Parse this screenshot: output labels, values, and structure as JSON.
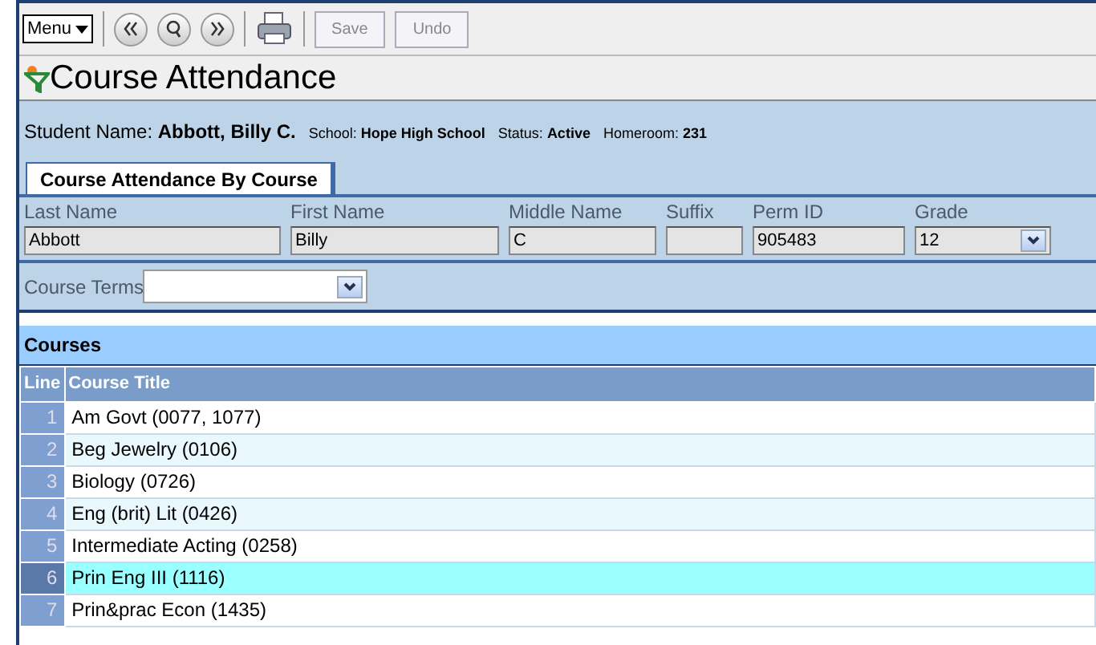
{
  "toolbar": {
    "menu": "Menu",
    "buttons": [
      {
        "label": "Save",
        "disabled": true
      },
      {
        "label": "Undo",
        "disabled": true
      }
    ]
  },
  "title": "Course Attendance",
  "student": [
    {
      "label": "Student Name:",
      "value": "Abbott, Billy C.",
      "kind": "large"
    },
    {
      "label": "School:",
      "value": "Hope High School",
      "kind": "small"
    },
    {
      "label": "Status:",
      "value": "Active",
      "kind": "small"
    },
    {
      "label": "Homeroom:",
      "value": "231",
      "kind": "small"
    }
  ],
  "tabs": [
    {
      "label": "Course Attendance By Course",
      "selected": true
    }
  ],
  "fields": [
    {
      "label": "Last Name",
      "value": "Abbott",
      "kind": "text"
    },
    {
      "label": "First Name",
      "value": "Billy",
      "kind": "text"
    },
    {
      "label": "Middle Name",
      "value": "C",
      "kind": "text"
    },
    {
      "label": "Suffix",
      "kind": "text"
    },
    {
      "label": "Perm ID",
      "value": "905483",
      "kind": "text"
    },
    {
      "label": "Grade",
      "value": "12",
      "kind": "select"
    }
  ],
  "course_terms": {
    "label": "Course Terms"
  },
  "courses": {
    "title": "Courses",
    "columns": [
      "Line",
      "Course Title"
    ],
    "rows": [
      {
        "line": "1",
        "title": "Am Govt (0077, 1077)",
        "selected": false
      },
      {
        "line": "2",
        "title": "Beg Jewelry (0106)",
        "selected": false
      },
      {
        "line": "3",
        "title": "Biology (0726)",
        "selected": false
      },
      {
        "line": "4",
        "title": "Eng (brit) Lit (0426)",
        "selected": false
      },
      {
        "line": "5",
        "title": "Intermediate Acting (0258)",
        "selected": false
      },
      {
        "line": "6",
        "title": "Prin Eng III (1116)",
        "selected": true
      },
      {
        "line": "7",
        "title": "Prin&prac Econ (1435)",
        "selected": false
      }
    ]
  }
}
